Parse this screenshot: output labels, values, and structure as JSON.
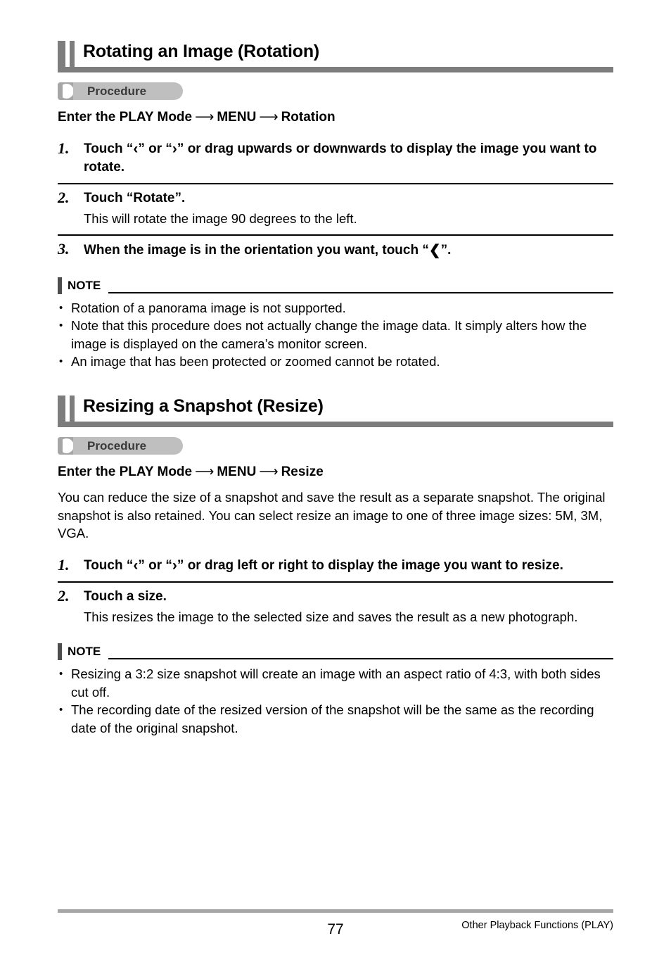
{
  "page": {
    "number": "77",
    "footer_caption": "Other Playback Functions (PLAY)"
  },
  "sections": [
    {
      "heading": "Rotating an Image (Rotation)",
      "procedure_label": "Procedure",
      "menu_path": {
        "part1": "Enter the PLAY Mode",
        "arrow1": "⟶",
        "part2": "MENU",
        "arrow2": "⟶",
        "part3": "Rotation"
      },
      "intro": "",
      "steps": [
        {
          "num": "1.",
          "title_pre": "Touch “",
          "glyph1": "‹",
          "title_mid": "” or “",
          "glyph2": "›",
          "title_post": "” or drag upwards or downwards to display the image you want to rotate.",
          "desc": ""
        },
        {
          "num": "2.",
          "title": "Touch “Rotate”.",
          "desc": "This will rotate the image 90 degrees to the left."
        },
        {
          "num": "3.",
          "title_pre": "When the image is in the orientation you want, touch “",
          "glyph1": "❮",
          "title_post": "”.",
          "desc": ""
        }
      ],
      "note": {
        "label": "NOTE",
        "items": [
          "Rotation of a panorama image is not supported.",
          "Note that this procedure does not actually change the image data. It simply alters how the image is displayed on the camera’s monitor screen.",
          "An image that has been protected or zoomed cannot be rotated."
        ]
      }
    },
    {
      "heading": "Resizing a Snapshot (Resize)",
      "procedure_label": "Procedure",
      "menu_path": {
        "part1": "Enter the PLAY Mode",
        "arrow1": "⟶",
        "part2": "MENU",
        "arrow2": "⟶",
        "part3": "Resize"
      },
      "intro": "You can reduce the size of a snapshot and save the result as a separate snapshot. The original snapshot is also retained. You can select resize an image to one of three image sizes: 5M, 3M, VGA.",
      "steps": [
        {
          "num": "1.",
          "title_pre": "Touch “",
          "glyph1": "‹",
          "title_mid": "” or “",
          "glyph2": "›",
          "title_post": "” or drag left or right to display the image you want to resize.",
          "desc": ""
        },
        {
          "num": "2.",
          "title": "Touch a size.",
          "desc": "This resizes the image to the selected size and saves the result as a new photograph."
        }
      ],
      "note": {
        "label": "NOTE",
        "items": [
          "Resizing a 3:2 size snapshot will create an image with an aspect ratio of 4:3, with both sides cut off.",
          "The recording date of the resized version of the snapshot will be the same as the recording date of the original snapshot."
        ]
      }
    }
  ],
  "colors": {
    "heading_bar": "#7d7d7d",
    "badge_pill": "#bfbfbf",
    "badge_tab": "#a6a6a6",
    "note_bar": "#4d4d4d",
    "footer_rule": "#a6a6a6"
  },
  "bullet": "•"
}
